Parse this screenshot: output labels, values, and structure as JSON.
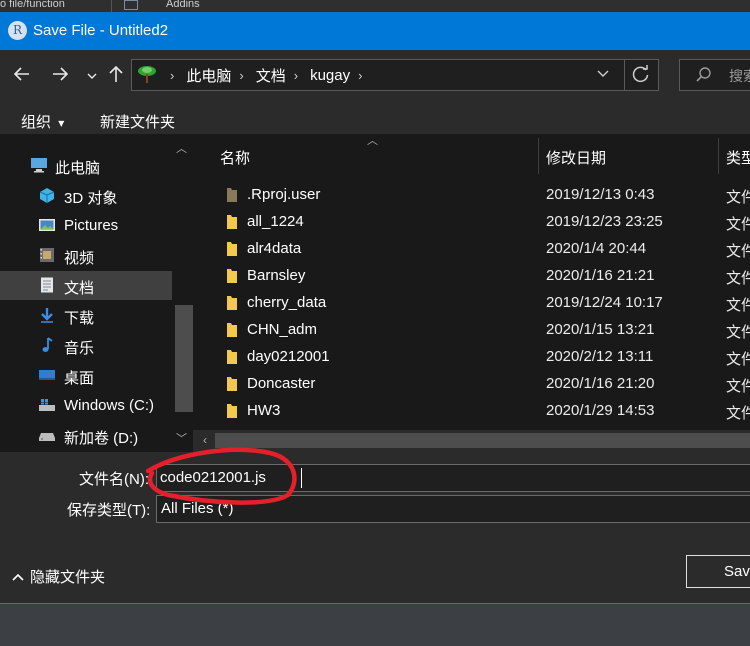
{
  "background_strip": {
    "left_label": "o file/function",
    "right_label": "Addins"
  },
  "title": "Save File - Untitled2",
  "app_icon_letter": "R",
  "address": {
    "crumbs": [
      "此电脑",
      "文档",
      "kugay"
    ]
  },
  "search_placeholder": "搜索",
  "toolbar": {
    "organize": "组织",
    "organize_arrow": "▾",
    "new_folder": "新建文件夹"
  },
  "nav_items": [
    {
      "label": "此电脑",
      "icon": "computer-icon"
    },
    {
      "label": "3D 对象",
      "icon": "3d-objects-icon"
    },
    {
      "label": "Pictures",
      "icon": "pictures-icon"
    },
    {
      "label": "视频",
      "icon": "videos-icon"
    },
    {
      "label": "文档",
      "icon": "documents-icon"
    },
    {
      "label": "下载",
      "icon": "downloads-icon"
    },
    {
      "label": "音乐",
      "icon": "music-icon"
    },
    {
      "label": "桌面",
      "icon": "desktop-icon"
    },
    {
      "label": "Windows (C:)",
      "icon": "drive-c-icon"
    },
    {
      "label": "新加卷 (D:)",
      "icon": "drive-d-icon"
    }
  ],
  "columns": {
    "name": "名称",
    "date": "修改日期",
    "type": "类型"
  },
  "files": [
    {
      "name": ".Rproj.user",
      "date": "2019/12/13 0:43",
      "type": "文件"
    },
    {
      "name": "all_1224",
      "date": "2019/12/23 23:25",
      "type": "文件"
    },
    {
      "name": "alr4data",
      "date": "2020/1/4 20:44",
      "type": "文件"
    },
    {
      "name": "Barnsley",
      "date": "2020/1/16 21:21",
      "type": "文件"
    },
    {
      "name": "cherry_data",
      "date": "2019/12/24 10:17",
      "type": "文件"
    },
    {
      "name": "CHN_adm",
      "date": "2020/1/15 13:21",
      "type": "文件"
    },
    {
      "name": "day0212001",
      "date": "2020/2/12 13:11",
      "type": "文件"
    },
    {
      "name": "Doncaster",
      "date": "2020/1/16 21:20",
      "type": "文件"
    },
    {
      "name": "HW3",
      "date": "2020/1/29 14:53",
      "type": "文件"
    }
  ],
  "form": {
    "filename_label": "文件名(N):",
    "filename_value": "code0212001.js",
    "filetype_label": "保存类型(T):",
    "filetype_value": "All Files (*)"
  },
  "hide_folders": "隐藏文件夹",
  "save_button": "Save",
  "colors": {
    "titlebar": "#0078d7",
    "dialog_bg": "#2b2b2b",
    "pane_bg": "#191919",
    "folder_yellow": "#f2c94c",
    "annotation_red": "#e5202a"
  }
}
